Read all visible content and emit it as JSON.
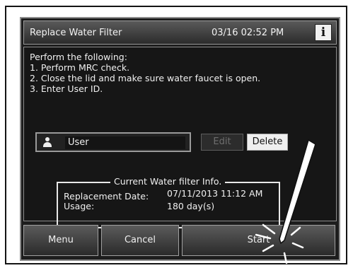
{
  "titlebar": {
    "title": "Replace Water Filter",
    "datetime": "03/16 02:52 PM",
    "info_glyph": "i"
  },
  "instructions": {
    "text": "Perform the following:\n1. Perform MRC check.\n2. Close the lid and make sure water faucet is open.\n3. Enter User ID."
  },
  "user": {
    "icon": "user-icon",
    "value": "User"
  },
  "buttons": {
    "edit": "Edit",
    "delete": "Delete",
    "menu": "Menu",
    "cancel": "Cancel",
    "start": "Start"
  },
  "filter_info": {
    "title": "Current Water filter Info.",
    "replacement_label": "Replacement Date:",
    "usage_label": "Usage:",
    "replacement_value": "07/11/2013 11:12 AM",
    "usage_value": "180 day(s)"
  },
  "colors": {
    "screen_bg": "#1d1d1d",
    "text": "#f0f0f0",
    "disabled_text": "#6e6e6e"
  }
}
